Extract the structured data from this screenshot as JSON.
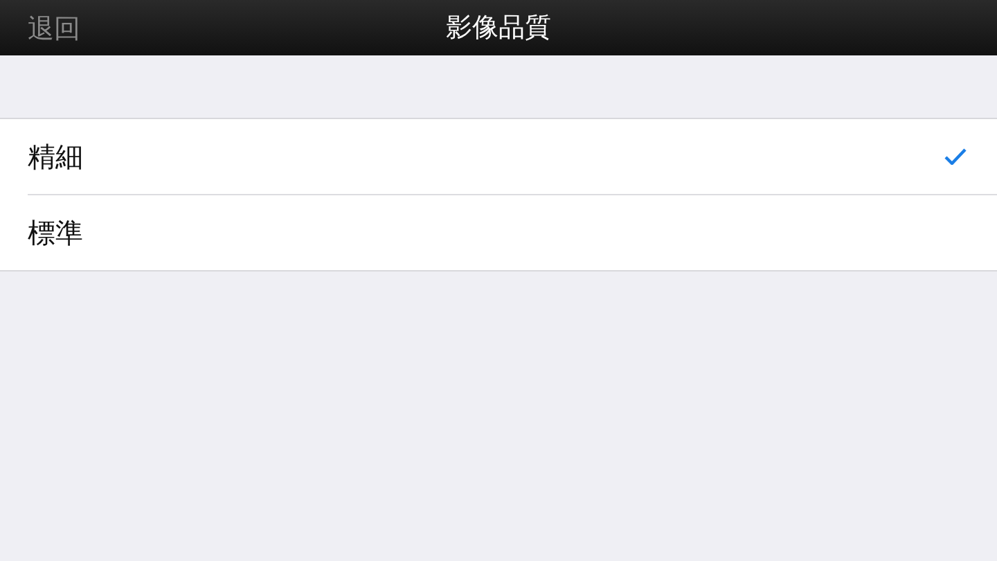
{
  "nav_bar": {
    "back": "退回",
    "title": "影像品質"
  },
  "options": [
    {
      "label": "精細",
      "selected": true
    },
    {
      "label": "標準",
      "selected": false
    }
  ]
}
